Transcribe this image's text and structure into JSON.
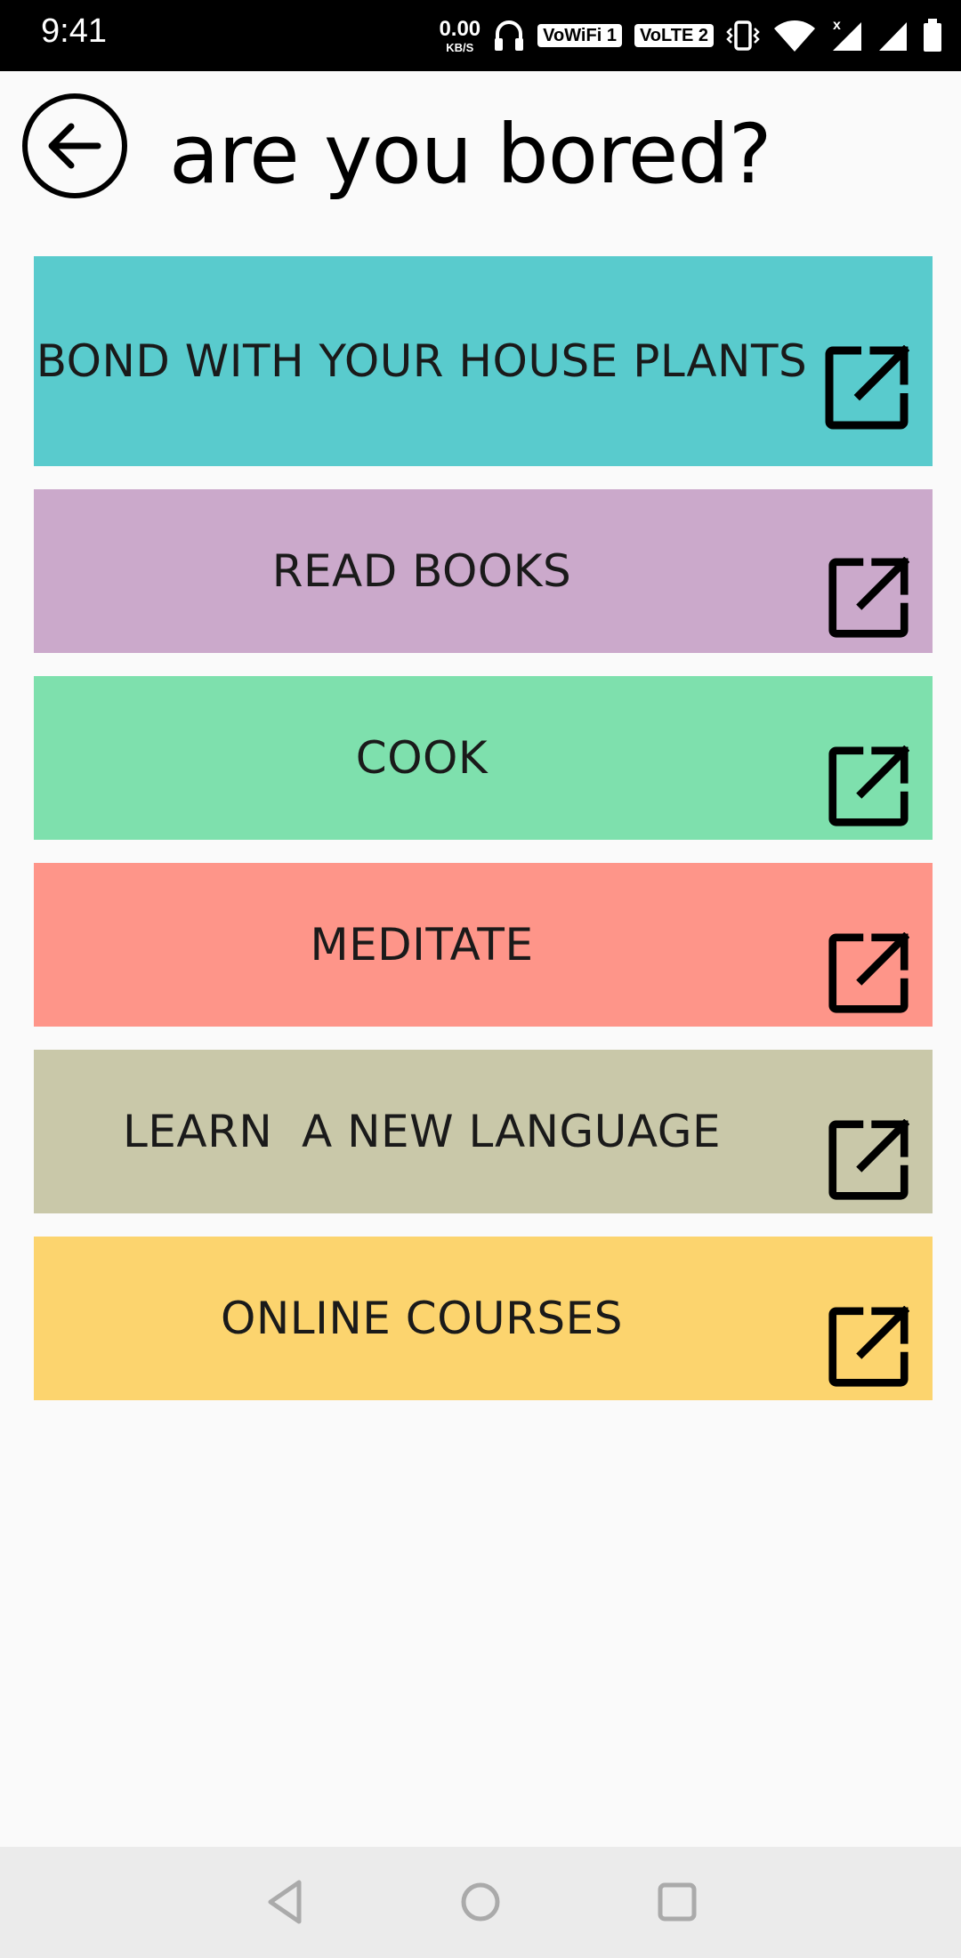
{
  "status_bar": {
    "time": "9:41",
    "net_speed_value": "0.00",
    "net_speed_unit": "KB/S",
    "wifi_badge": "VoWiFi 1",
    "lte_badge": "VoLTE 2",
    "icons": [
      "headphones-icon",
      "vibrate-icon",
      "wifi-icon",
      "signal-icon",
      "signal-icon",
      "battery-icon"
    ]
  },
  "header": {
    "title": "are you bored?",
    "back_icon": "back-arrow-icon"
  },
  "items": [
    {
      "label": "BOND WITH YOUR HOUSE PLANTS",
      "color": "#59cbcd",
      "icon": "open-in-new-icon"
    },
    {
      "label": "READ BOOKS",
      "color": "#cba9cb",
      "icon": "open-in-new-icon"
    },
    {
      "label": "COOK",
      "color": "#7ee0ad",
      "icon": "open-in-new-icon"
    },
    {
      "label": "MEDITATE",
      "color": "#fe9589",
      "icon": "open-in-new-icon"
    },
    {
      "label": "LEARN  A NEW LANGUAGE",
      "color": "#c9c8a9",
      "icon": "open-in-new-icon"
    },
    {
      "label": "ONLINE COURSES",
      "color": "#fcd46e",
      "icon": "open-in-new-icon"
    }
  ],
  "nav_bar": {
    "icons": [
      "back-triangle-icon",
      "home-circle-icon",
      "recents-square-icon"
    ]
  }
}
